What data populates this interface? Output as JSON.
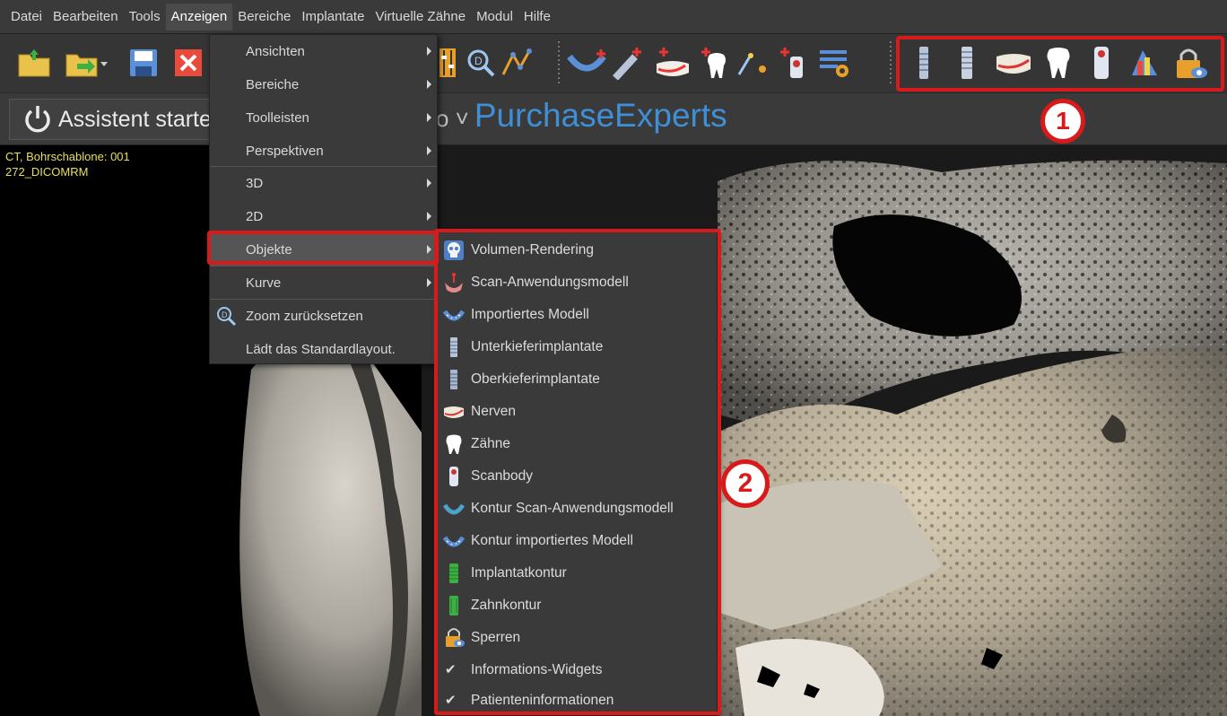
{
  "menubar": {
    "items": [
      {
        "label": "Datei"
      },
      {
        "label": "Bearbeiten"
      },
      {
        "label": "Tools"
      },
      {
        "label": "Anzeigen",
        "active": true
      },
      {
        "label": "Bereiche"
      },
      {
        "label": "Implantate"
      },
      {
        "label": "Virtuelle Zähne"
      },
      {
        "label": "Modul"
      },
      {
        "label": "Hilfe"
      }
    ]
  },
  "toolbar": {
    "left_icons": [
      "open-folder-icon",
      "open-folder-arrow-icon",
      "save-icon",
      "close-x-icon"
    ],
    "middle_icons": [
      "slider-adjust-icon",
      "zoom-icon",
      "curve-tool-icon",
      "add-model-icon",
      "add-implant-icon",
      "add-nerve-icon",
      "add-tooth-icon",
      "add-scanbody-icon",
      "add-scanbody-2-icon",
      "layout-settings-icon"
    ],
    "object_icons": [
      "lower-implant-icon",
      "upper-implant-icon",
      "nerve-icon",
      "tooth-icon",
      "scanbody-icon",
      "implant-contour-icon",
      "lock-icon"
    ]
  },
  "assistbar": {
    "assistant_label": "Assistent starte",
    "brand_prefix": "o ˅",
    "brand_name": "PurchaseExperts"
  },
  "callouts": {
    "one": "1",
    "two": "2"
  },
  "viewport": {
    "info_line1": "CT, Bohrschablone: 001",
    "info_line2": "272_DICOMRM"
  },
  "anzeigen_menu": {
    "items": [
      {
        "label": "Ansichten",
        "submenu": true
      },
      {
        "label": "Bereiche",
        "submenu": true
      },
      {
        "label": "Toolleisten",
        "submenu": true
      },
      {
        "label": "Perspektiven",
        "submenu": true
      },
      {
        "label": "3D",
        "submenu": true
      },
      {
        "label": "2D",
        "submenu": true
      },
      {
        "label": "Objekte",
        "submenu": true,
        "selected": true
      },
      {
        "label": "Kurve",
        "submenu": true
      },
      {
        "label": "Zoom zurücksetzen",
        "icon": "zoom-reset-icon"
      },
      {
        "label": "Lädt das Standardlayout."
      }
    ]
  },
  "objekte_menu": {
    "items": [
      {
        "label": "Volumen-Rendering",
        "icon": "skull-icon"
      },
      {
        "label": "Scan-Anwendungsmodell",
        "icon": "scan-model-icon"
      },
      {
        "label": "Importiertes Modell",
        "icon": "imported-model-icon"
      },
      {
        "label": "Unterkieferimplantate",
        "icon": "lower-implant-icon"
      },
      {
        "label": "Oberkieferimplantate",
        "icon": "upper-implant-icon"
      },
      {
        "label": "Nerven",
        "icon": "nerve-icon"
      },
      {
        "label": "Zähne",
        "icon": "tooth-icon"
      },
      {
        "label": "Scanbody",
        "icon": "scanbody-icon"
      },
      {
        "label": "Kontur Scan-Anwendungsmodell",
        "icon": "scan-model-contour-icon"
      },
      {
        "label": "Kontur importiertes Modell",
        "icon": "imported-model-contour-icon"
      },
      {
        "label": "Implantatkontur",
        "icon": "implant-contour-icon"
      },
      {
        "label": "Zahnkontur",
        "icon": "tooth-contour-icon"
      },
      {
        "label": "Sperren",
        "icon": "lock-icon"
      },
      {
        "label": "Informations-Widgets",
        "checked": true
      },
      {
        "label": "Patienteninformationen",
        "checked": true
      }
    ]
  },
  "colors": {
    "callout_red": "#d91a1a",
    "brand_blue": "#3f8fd6",
    "info_yellow": "#e6e05a"
  }
}
